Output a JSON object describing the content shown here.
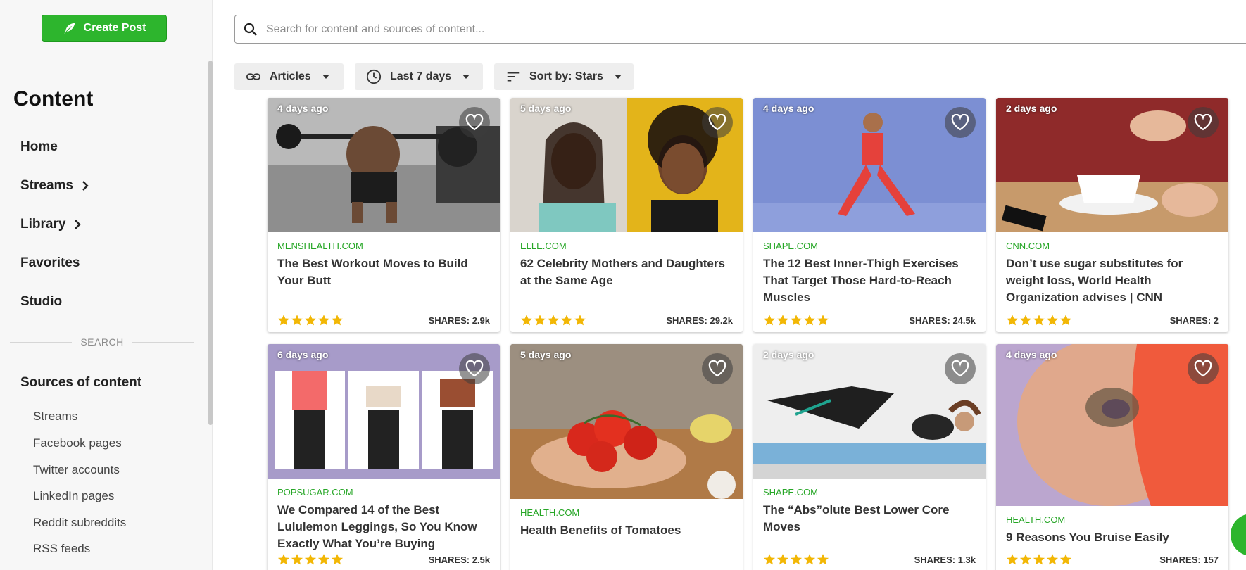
{
  "sidebar": {
    "create_post_label": "Create Post",
    "section_title": "Content",
    "nav": [
      "Home",
      "Streams",
      "Library",
      "Favorites",
      "Studio"
    ],
    "divider_label": "SEARCH",
    "sources_title": "Sources of content",
    "sources": [
      "Streams",
      "Facebook pages",
      "Twitter accounts",
      "LinkedIn pages",
      "Reddit subreddits",
      "RSS feeds"
    ]
  },
  "search": {
    "placeholder": "Search for content and sources of content..."
  },
  "filters": {
    "type": "Articles",
    "time": "Last 7 days",
    "sort": "Sort by: Stars"
  },
  "colors": {
    "accent": "#2db52d",
    "source": "#26a626",
    "star": "#f2b705"
  },
  "cards": [
    {
      "age": "4 days ago",
      "source": "MENSHEALTH.COM",
      "title": "The Best Workout Moves to Build Your Butt",
      "stars": 5,
      "shares": "SHARES: 2.9k"
    },
    {
      "age": "5 days ago",
      "source": "ELLE.COM",
      "title": "62 Celebrity Mothers and Daughters at the Same Age",
      "stars": 5,
      "shares": "SHARES: 29.2k"
    },
    {
      "age": "4 days ago",
      "source": "SHAPE.COM",
      "title": "The 12 Best Inner-Thigh Exercises That Target Those Hard-to-Reach Muscles",
      "stars": 5,
      "shares": "SHARES: 24.5k"
    },
    {
      "age": "2 days ago",
      "source": "CNN.COM",
      "title": "Don’t use sugar substitutes for weight loss, World Health Organization advises | CNN",
      "stars": 5,
      "shares": "SHARES: 2"
    },
    {
      "age": "6 days ago",
      "source": "POPSUGAR.COM",
      "title": "We Compared 14 of the Best Lululemon Leggings, So You Know Exactly What You’re Buying",
      "stars": 5,
      "shares": "SHARES: 2.5k"
    },
    {
      "age": "5 days ago",
      "source": "HEALTH.COM",
      "title": "Health Benefits of Tomatoes",
      "stars": 0,
      "shares": ""
    },
    {
      "age": "2 days ago",
      "source": "SHAPE.COM",
      "title": "The “Abs”olute Best Lower Core Moves",
      "stars": 5,
      "shares": "SHARES: 1.3k"
    },
    {
      "age": "4 days ago",
      "source": "HEALTH.COM",
      "title": "9 Reasons You Bruise Easily",
      "stars": 5,
      "shares": "SHARES: 157"
    }
  ]
}
